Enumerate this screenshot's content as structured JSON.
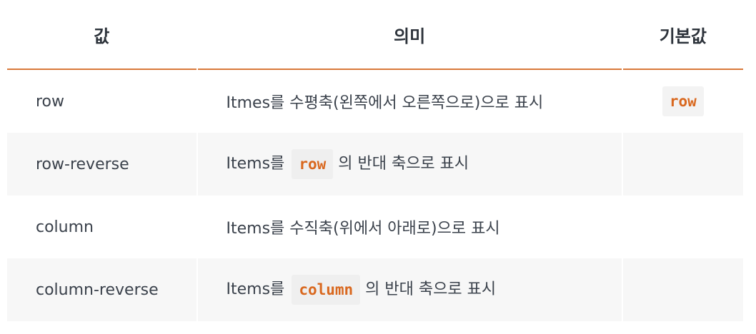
{
  "header": {
    "col_value": "값",
    "col_meaning": "의미",
    "col_default": "기본값"
  },
  "rows": [
    {
      "value": "row",
      "meaning_before": "Itmes를 수평축(왼쪽에서 오른쪽으로)으로 표시",
      "meaning_code": "",
      "meaning_after": "",
      "default": "row"
    },
    {
      "value": "row-reverse",
      "meaning_before": "Items를",
      "meaning_code": "row",
      "meaning_after": "의 반대 축으로 표시",
      "default": ""
    },
    {
      "value": "column",
      "meaning_before": "Items를 수직축(위에서 아래로)으로 표시",
      "meaning_code": "",
      "meaning_after": "",
      "default": ""
    },
    {
      "value": "column-reverse",
      "meaning_before": "Items를",
      "meaning_code": "column",
      "meaning_after": "의 반대 축으로 표시",
      "default": ""
    }
  ],
  "colors": {
    "accent": "#d9793a",
    "code_text": "#d9681f",
    "stripe": "#f7f7f7"
  }
}
